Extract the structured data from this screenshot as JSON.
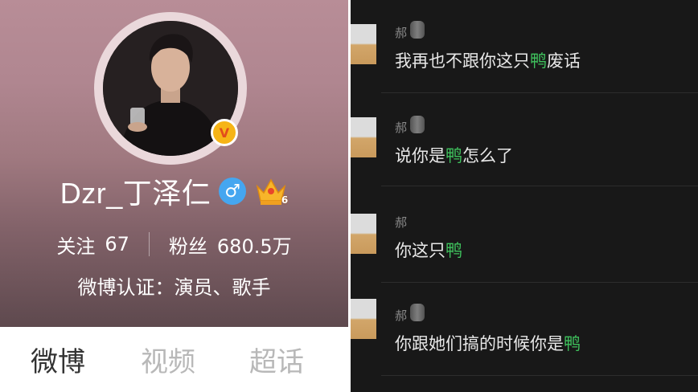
{
  "profile": {
    "username": "Dzr_丁泽仁",
    "verified_badge": "V",
    "gender_symbol": "♂",
    "vip_level": "6",
    "stats": [
      {
        "label": "关注",
        "value": "67"
      },
      {
        "label": "粉丝",
        "value": "680.5万"
      }
    ],
    "verification": "微博认证：演员、歌手",
    "tabs": [
      {
        "label": "微博",
        "active": true
      },
      {
        "label": "视频",
        "active": false
      },
      {
        "label": "超话",
        "active": false
      }
    ],
    "colors": {
      "verify": "#f6b417",
      "gender": "#45a6f0"
    }
  },
  "comments": [
    {
      "author": "郝",
      "text_before": "我再也不跟你这只",
      "highlight": "鸭",
      "text_after": "废话"
    },
    {
      "author": "郝",
      "text_before": "说你是",
      "highlight": "鸭",
      "text_after": "怎么了"
    },
    {
      "author": "郝",
      "text_before": "你这只",
      "highlight": "鸭",
      "text_after": ""
    },
    {
      "author": "郝",
      "text_before": "你跟她们搞的时候你是",
      "highlight": "鸭",
      "text_after": ""
    }
  ],
  "colors": {
    "highlight": "#3fc25d",
    "comment_bg": "#181818"
  }
}
